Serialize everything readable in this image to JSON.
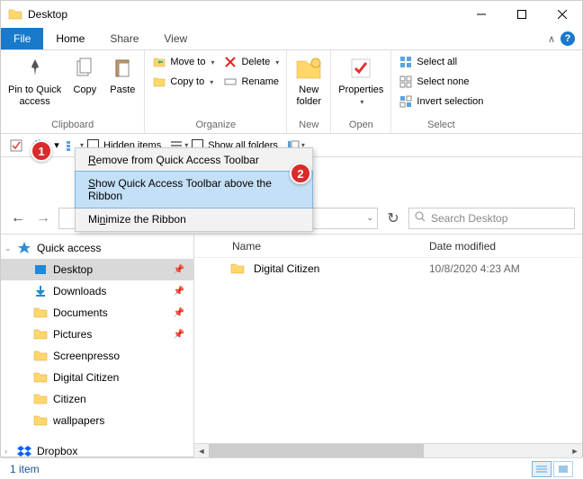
{
  "window": {
    "title": "Desktop"
  },
  "tabs": {
    "file": "File",
    "home": "Home",
    "share": "Share",
    "view": "View"
  },
  "ribbon": {
    "clipboard": {
      "label": "Clipboard",
      "pin": "Pin to Quick\naccess",
      "copy": "Copy",
      "paste": "Paste"
    },
    "organize": {
      "label": "Organize",
      "move": "Move to",
      "copy": "Copy to",
      "delete": "Delete",
      "rename": "Rename"
    },
    "new": {
      "label": "New",
      "folder": "New\nfolder"
    },
    "open": {
      "label": "Open",
      "props": "Properties"
    },
    "select": {
      "label": "Select",
      "all": "Select all",
      "none": "Select none",
      "invert": "Invert selection"
    }
  },
  "qat": {
    "hidden": "Hidden items",
    "showall": "Show all folders"
  },
  "context": {
    "remove": "emove from Quick Access Toolbar",
    "remove_u": "R",
    "show": "how Quick Access Toolbar above the Ribbon",
    "show_u": "S",
    "min": "Mi",
    "min_rest": "imize the Ribbon",
    "min_u": "n"
  },
  "search": {
    "placeholder": "Search Desktop"
  },
  "columns": {
    "name": "Name",
    "date": "Date modified"
  },
  "items": [
    {
      "name": "Digital Citizen",
      "date": "10/8/2020 4:23 AM"
    }
  ],
  "sidebar": {
    "quick": "Quick access",
    "entries": [
      {
        "label": "Desktop",
        "selected": true,
        "pin": true,
        "color": "#1f8ad6"
      },
      {
        "label": "Downloads",
        "selected": false,
        "pin": true,
        "color": "#1f8ad6"
      },
      {
        "label": "Documents",
        "selected": false,
        "pin": true,
        "color": "#ffd76b"
      },
      {
        "label": "Pictures",
        "selected": false,
        "pin": true,
        "color": "#ffd76b"
      },
      {
        "label": "Screenpresso",
        "selected": false,
        "pin": false,
        "color": "#ffd76b"
      },
      {
        "label": "Digital Citizen",
        "selected": false,
        "pin": false,
        "color": "#ffd76b"
      },
      {
        "label": "Citizen",
        "selected": false,
        "pin": false,
        "color": "#ffd76b"
      },
      {
        "label": "wallpapers",
        "selected": false,
        "pin": false,
        "color": "#ffd76b"
      }
    ],
    "dropbox": "Dropbox"
  },
  "status": {
    "text": "1 item"
  },
  "badges": {
    "one": "1",
    "two": "2"
  }
}
